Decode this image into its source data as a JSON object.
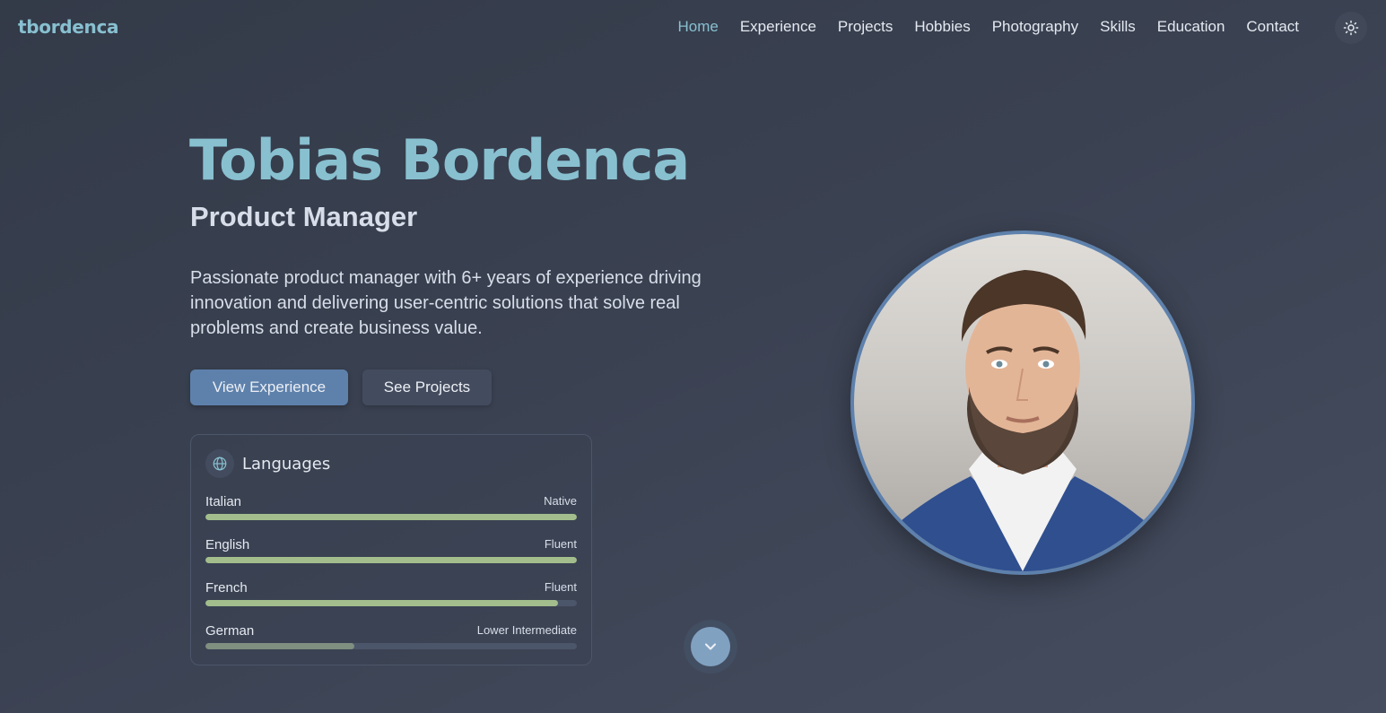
{
  "brand": "tbordenca",
  "nav": {
    "items": [
      {
        "label": "Home",
        "active": true
      },
      {
        "label": "Experience",
        "active": false
      },
      {
        "label": "Projects",
        "active": false
      },
      {
        "label": "Hobbies",
        "active": false
      },
      {
        "label": "Photography",
        "active": false
      },
      {
        "label": "Skills",
        "active": false
      },
      {
        "label": "Education",
        "active": false
      },
      {
        "label": "Contact",
        "active": false
      }
    ],
    "theme_icon": "sun-icon"
  },
  "hero": {
    "name": "Tobias Bordenca",
    "role": "Product Manager",
    "description": "Passionate product manager with 6+ years of experience driving innovation and delivering user-centric solutions that solve real problems and create business value.",
    "primary_button": "View Experience",
    "secondary_button": "See Projects"
  },
  "languages": {
    "title": "Languages",
    "icon": "globe-icon",
    "items": [
      {
        "name": "Italian",
        "level": "Native",
        "proficiency": 1.0,
        "color": "#a3be8c"
      },
      {
        "name": "English",
        "level": "Fluent",
        "proficiency": 1.0,
        "color": "#a3be8c"
      },
      {
        "name": "French",
        "level": "Fluent",
        "proficiency": 0.95,
        "color": "#a3be8c"
      },
      {
        "name": "German",
        "level": "Lower Intermediate",
        "proficiency": 0.4,
        "color": "#7f8f80"
      }
    ]
  },
  "scroll_icon": "chevron-down-icon",
  "colors": {
    "accent": "#88c0d0",
    "primary": "#5e81ac",
    "progress": "#a3be8c",
    "background": "#3b4252"
  }
}
